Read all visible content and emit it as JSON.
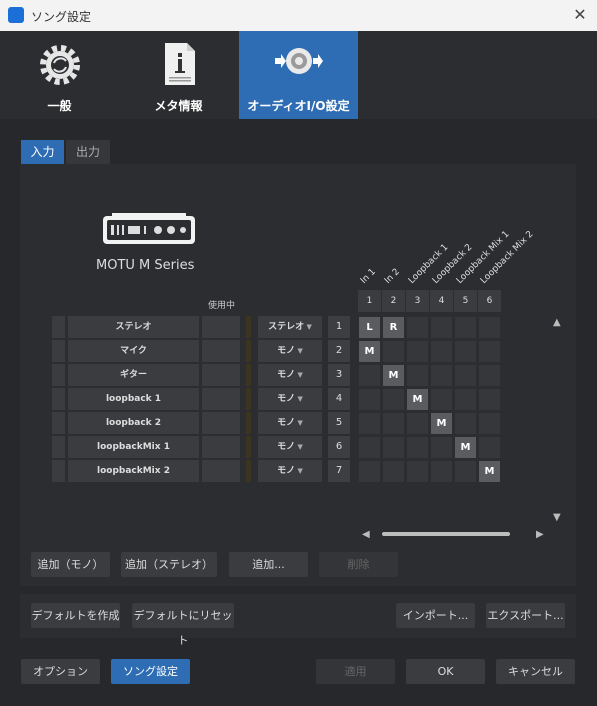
{
  "window": {
    "title": "ソング設定"
  },
  "top_tabs": [
    {
      "label": "一般",
      "icon": "gear-refresh-icon"
    },
    {
      "label": "メタ情報",
      "icon": "info-document-icon"
    },
    {
      "label": "オーディオI/O設定",
      "icon": "audio-io-icon"
    }
  ],
  "sub_tabs": [
    "入力",
    "出力"
  ],
  "device": {
    "name": "MOTU M Series"
  },
  "using_label": "使用中",
  "columns": [
    {
      "num": "1",
      "label": "In 1"
    },
    {
      "num": "2",
      "label": "In 2"
    },
    {
      "num": "3",
      "label": "Loopback 1"
    },
    {
      "num": "4",
      "label": "Loopback 2"
    },
    {
      "num": "5",
      "label": "Loopback Mix 1"
    },
    {
      "num": "6",
      "label": "Loopback Mix 2"
    }
  ],
  "rows": [
    {
      "name": "ステレオ",
      "type": "ステレオ",
      "num": "1",
      "cells": [
        "L",
        "R",
        "",
        "",
        "",
        ""
      ]
    },
    {
      "name": "マイク",
      "type": "モノ",
      "num": "2",
      "cells": [
        "M",
        "",
        "",
        "",
        "",
        ""
      ]
    },
    {
      "name": "ギター",
      "type": "モノ",
      "num": "3",
      "cells": [
        "",
        "M",
        "",
        "",
        "",
        ""
      ]
    },
    {
      "name": "loopback 1",
      "type": "モノ",
      "num": "4",
      "cells": [
        "",
        "",
        "M",
        "",
        "",
        ""
      ]
    },
    {
      "name": "loopback 2",
      "type": "モノ",
      "num": "5",
      "cells": [
        "",
        "",
        "",
        "M",
        "",
        ""
      ]
    },
    {
      "name": "loopbackMix 1",
      "type": "モノ",
      "num": "6",
      "cells": [
        "",
        "",
        "",
        "",
        "M",
        ""
      ]
    },
    {
      "name": "loopbackMix 2",
      "type": "モノ",
      "num": "7",
      "cells": [
        "",
        "",
        "",
        "",
        "",
        "M"
      ]
    }
  ],
  "panel_buttons": {
    "add_mono": "追加（モノ）",
    "add_stereo": "追加（ステレオ）",
    "add": "追加...",
    "delete": "削除"
  },
  "preset_buttons": {
    "create_default": "デフォルトを作成",
    "reset_default": "デフォルトにリセット",
    "import": "インポート...",
    "export": "エクスポート..."
  },
  "footer_buttons": {
    "options": "オプション",
    "song_settings": "ソング設定",
    "apply": "適用",
    "ok": "OK",
    "cancel": "キャンセル"
  },
  "colors": {
    "accent": "#2e6db4",
    "bg": "#26282b"
  }
}
